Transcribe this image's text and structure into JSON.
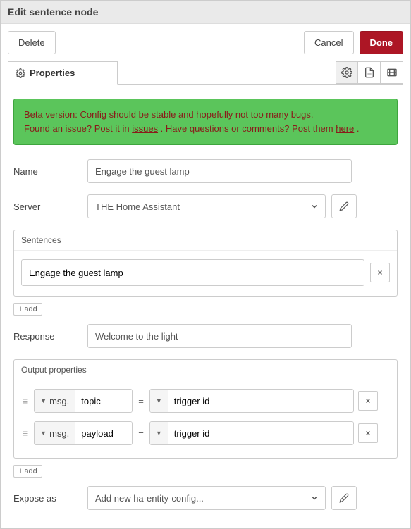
{
  "header": {
    "title": "Edit sentence node"
  },
  "buttons": {
    "delete": "Delete",
    "cancel": "Cancel",
    "done": "Done"
  },
  "tabs": {
    "properties": "Properties"
  },
  "notice": {
    "line1_pre": "Beta version: Config should be stable and hopefully not too many bugs.",
    "line2a": "Found an issue? Post it in ",
    "line2a_link": "issues",
    "line2b": " . Have questions or comments? Post them ",
    "line2b_link": "here",
    "line2c": " ."
  },
  "labels": {
    "name": "Name",
    "server": "Server",
    "sentences": "Sentences",
    "response": "Response",
    "output": "Output properties",
    "expose": "Expose as",
    "add": "add"
  },
  "values": {
    "name": "Engage the guest lamp",
    "server": "THE Home Assistant",
    "sentence0": "Engage the guest lamp",
    "response": "Welcome to the light",
    "expose": "Add new ha-entity-config..."
  },
  "output": {
    "msg_prefix": "msg.",
    "rows": [
      {
        "prop": "topic",
        "val": "trigger id"
      },
      {
        "prop": "payload",
        "val": "trigger id"
      }
    ]
  }
}
